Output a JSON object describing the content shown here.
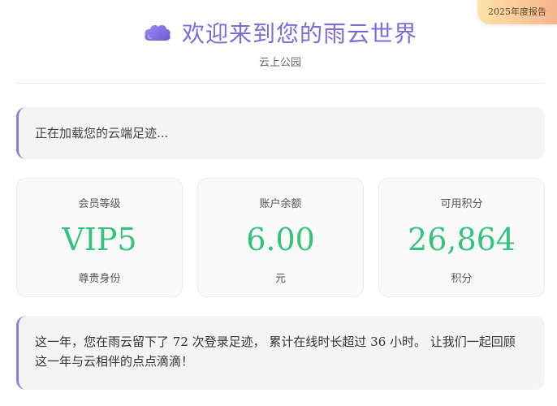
{
  "badge": {
    "label": "2025年度报告"
  },
  "header": {
    "icon": "cloud-icon",
    "title": "欢迎来到您的雨云世界",
    "subtitle": "云上公园"
  },
  "loading": {
    "text": "正在加载您的云端足迹..."
  },
  "stats": [
    {
      "label": "会员等级",
      "value": "VIP5",
      "unit": "尊贵身份"
    },
    {
      "label": "账户余额",
      "value": "6.00",
      "unit": "元"
    },
    {
      "label": "可用积分",
      "value": "26,864",
      "unit": "积分"
    }
  ],
  "summary": {
    "line1": "这一年，您在雨云留下了 72 次登录足迹， 累计在线时长超过 36 小时。 让我们一起回顾",
    "line2": "这一年与云相伴的点点滴滴！"
  },
  "colors": {
    "accent": "#7d6bdc",
    "value_green": "#33c47a",
    "badge_gradient_start": "#fbe3a6",
    "badge_gradient_end": "#f7b48f"
  }
}
